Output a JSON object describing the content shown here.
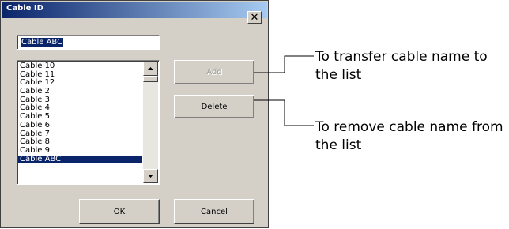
{
  "window": {
    "title": "Cable ID",
    "close_glyph": "✕",
    "close_icon": "close-icon"
  },
  "input": {
    "value": "Cable ABC"
  },
  "list": {
    "items": [
      "Cable 10",
      "Cable 11",
      "Cable 12",
      "Cable 2",
      "Cable 3",
      "Cable 4",
      "Cable 5",
      "Cable 6",
      "Cable 7",
      "Cable 8",
      "Cable 9",
      "Cable ABC"
    ],
    "selected_index": 11,
    "scroll_up_icon": "arrow-up-icon",
    "scroll_down_icon": "arrow-down-icon"
  },
  "buttons": {
    "add": "Add",
    "delete": "Delete",
    "ok": "OK",
    "cancel": "Cancel"
  },
  "annotations": {
    "transfer": "To transfer cable name to the list",
    "remove": "To remove cable name from the list"
  },
  "colors": {
    "dialog_bg": "#d4d0c8",
    "title_bar": "#0a246a",
    "selection": "#0a246a"
  }
}
